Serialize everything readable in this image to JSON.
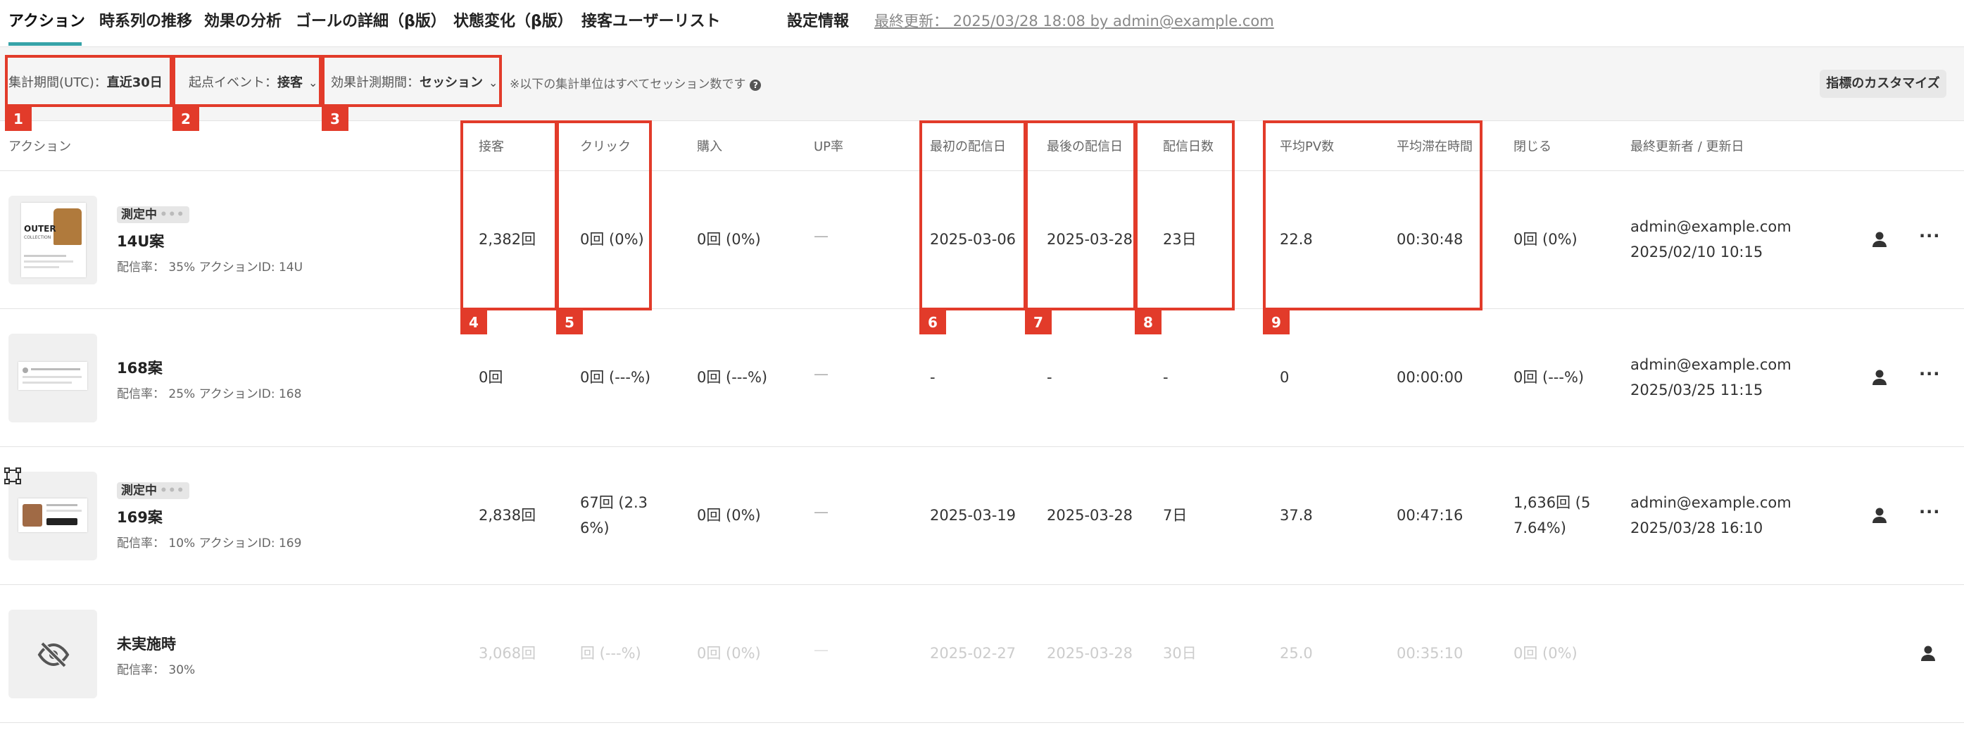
{
  "tabs": [
    {
      "label": "アクション",
      "active": true
    },
    {
      "label": "時系列の推移"
    },
    {
      "label": "効果の分析"
    },
    {
      "label": "ゴールの詳細（β版）"
    },
    {
      "label": "状態変化（β版）"
    },
    {
      "label": "接客ユーザーリスト"
    },
    {
      "label": "設定情報"
    }
  ],
  "last_updated": "最終更新： 2025/03/28 18:08 by admin@example.com",
  "filters": {
    "period_prefix": "集計期間(UTC)：",
    "period_value": "直近30日",
    "event_prefix": "起点イベント：",
    "event_value": "接客",
    "measure_prefix": "効果計測期間：",
    "measure_value": "セッション",
    "note": "※以下の集計単位はすべてセッション数です",
    "customize_label": "指標のカスタマイズ"
  },
  "columns": [
    "アクション",
    "接客",
    "クリック",
    "購入",
    "UP率",
    "最初の配信日",
    "最後の配信日",
    "配信日数",
    "平均PV数",
    "平均滞在時間",
    "閉じる",
    "最終更新者 / 更新日"
  ],
  "rows": [
    {
      "badge": "測定中",
      "badge_dots": "•••",
      "name": "14U案",
      "meta": "配信率： 35% アクションID: 14U",
      "serve": "2,382回",
      "click": "0回 (0%)",
      "purchase": "0回 (0%)",
      "up": "—",
      "first": "2025-03-06",
      "last": "2025-03-28",
      "days": "23日",
      "pv": "22.8",
      "stay": "00:30:48",
      "close": "0回 (0%)",
      "close2": "",
      "updater": "admin@example.com",
      "updated": "2025/02/10 10:15",
      "thumb_text_1": "OUTER",
      "thumb_text_2": "COLLECTION"
    },
    {
      "badge": "",
      "name": "168案",
      "meta": "配信率： 25% アクションID: 168",
      "serve": "0回",
      "click": "0回 (---%)",
      "purchase": "0回 (---%)",
      "up": "—",
      "first": "-",
      "last": "-",
      "days": "-",
      "pv": "0",
      "stay": "00:00:00",
      "close": "0回 (---%)",
      "close2": "",
      "updater": "admin@example.com",
      "updated": "2025/03/25 11:15"
    },
    {
      "badge": "測定中",
      "badge_dots": "•••",
      "name": "169案",
      "meta": "配信率： 10% アクションID: 169",
      "serve": "2,838回",
      "click": "67回 (2.3",
      "click2": "6%)",
      "purchase": "0回 (0%)",
      "up": "—",
      "first": "2025-03-19",
      "last": "2025-03-28",
      "days": "7日",
      "pv": "37.8",
      "stay": "00:47:16",
      "close": "1,636回 (5",
      "close2": "7.64%)",
      "updater": "admin@example.com",
      "updated": "2025/03/28 16:10"
    },
    {
      "badge": "",
      "name": "未実施時",
      "meta": "配信率： 30%",
      "serve": "3,068回",
      "click": "回 (---%)",
      "purchase": "0回 (0%)",
      "up": "—",
      "first": "2025-02-27",
      "last": "2025-03-28",
      "days": "30日",
      "pv": "25.0",
      "stay": "00:35:10",
      "close": "0回 (0%)",
      "close2": "",
      "updater": "",
      "updated": ""
    }
  ],
  "markers": [
    "1",
    "2",
    "3",
    "4",
    "5",
    "6",
    "7",
    "8",
    "9"
  ],
  "colors": {
    "accent": "#36a3a8",
    "highlight": "#e23b2a"
  }
}
